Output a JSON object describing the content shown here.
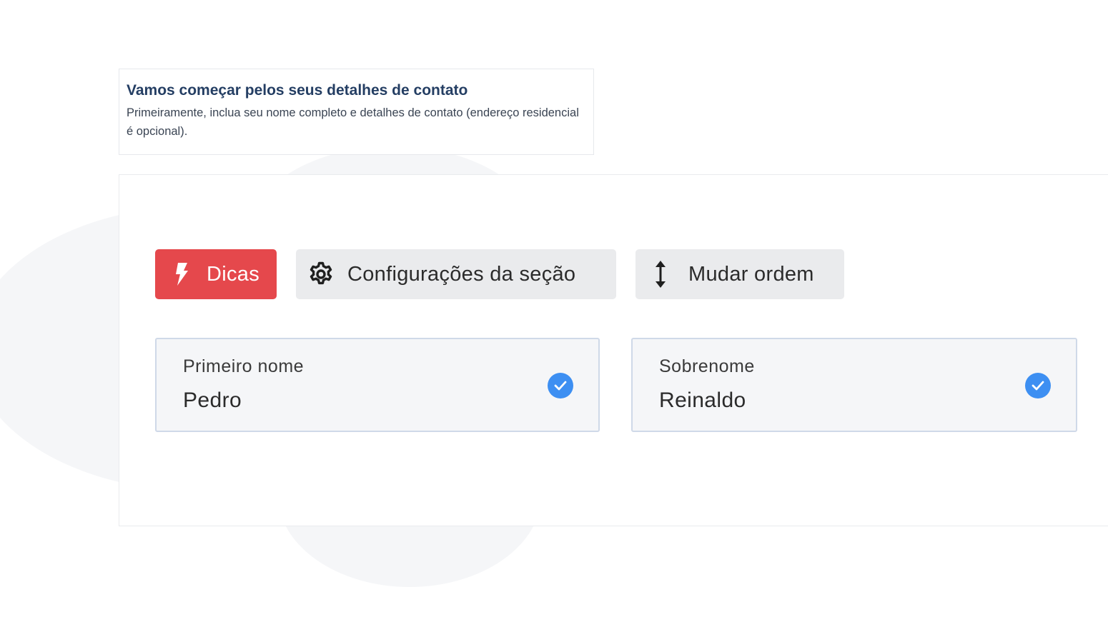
{
  "intro": {
    "title": "Vamos começar pelos seus detalhes de contato",
    "description": "Primeiramente, inclua seu nome completo e detalhes de contato (endereço residencial é opcional)."
  },
  "toolbar": {
    "tips_label": "Dicas",
    "tips_icon": "lightning-icon",
    "settings_label": "Configurações da seção",
    "settings_icon": "gear-icon",
    "order_label": "Mudar ordem",
    "order_icon": "vertical-arrows-icon"
  },
  "fields": {
    "first_name": {
      "label": "Primeiro nome",
      "value": "Pedro",
      "validated": true
    },
    "last_name": {
      "label": "Sobrenome",
      "value": "Reinaldo",
      "validated": true
    }
  },
  "colors": {
    "tips_button": "#e5484c",
    "secondary_button": "#eaebed",
    "check_badge": "#3d8ff2",
    "title_text": "#243e63",
    "field_border": "#cfd9e8"
  }
}
